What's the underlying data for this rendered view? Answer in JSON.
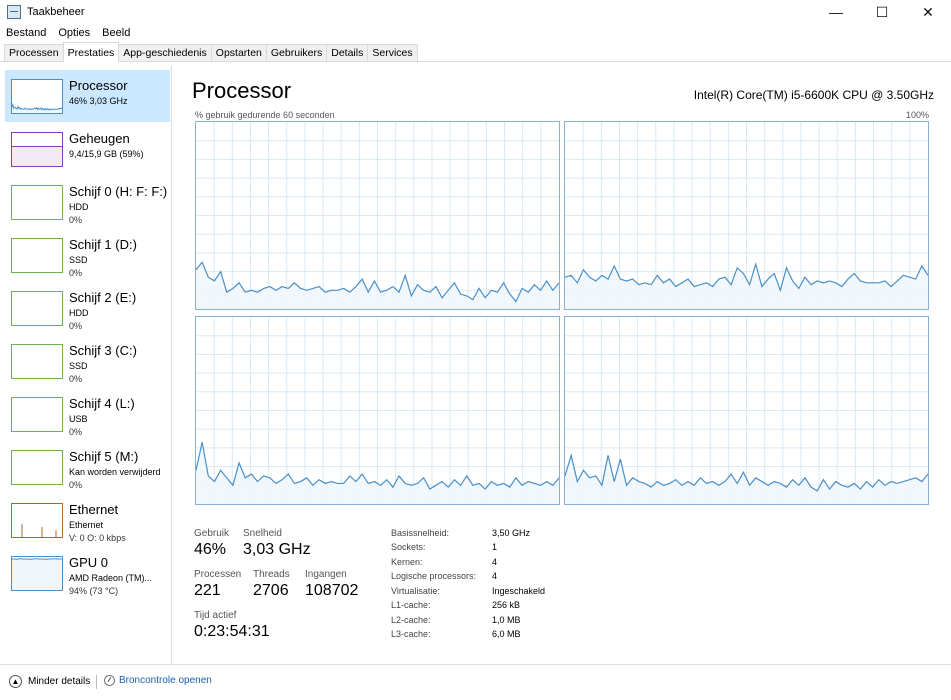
{
  "window": {
    "title": "Taakbeheer",
    "minimize": "—",
    "maximize": "☐",
    "close": "✕"
  },
  "menu": [
    "Bestand",
    "Opties",
    "Beeld"
  ],
  "tabs": [
    "Processen",
    "Prestaties",
    "App-geschiedenis",
    "Opstarten",
    "Gebruikers",
    "Details",
    "Services"
  ],
  "active_tab": "Prestaties",
  "sidebar": [
    {
      "name": "Processor",
      "line1": "46% 3,03 GHz",
      "line2": "",
      "color": "#4a90c8",
      "fill": "#f1f6fb",
      "active": true
    },
    {
      "name": "Geheugen",
      "line1": "9,4/15,9 GB (59%)",
      "line2": "",
      "color": "#8b3bb7",
      "fill": "#f3e9f8",
      "active": false
    },
    {
      "name": "Schijf 0 (H: F: F:)",
      "line1": "HDD",
      "line2": "0%",
      "color": "#6fb14a",
      "fill": "#ffffff",
      "active": false
    },
    {
      "name": "Schijf 1 (D:)",
      "line1": "SSD",
      "line2": "0%",
      "color": "#6fb14a",
      "fill": "#ffffff",
      "active": false
    },
    {
      "name": "Schijf 2 (E:)",
      "line1": "HDD",
      "line2": "0%",
      "color": "#6fb14a",
      "fill": "#ffffff",
      "active": false
    },
    {
      "name": "Schijf 3 (C:)",
      "line1": "SSD",
      "line2": "0%",
      "color": "#6fb14a",
      "fill": "#ffffff",
      "active": false
    },
    {
      "name": "Schijf 4 (L:)",
      "line1": "USB",
      "line2": "0%",
      "color": "#6fb14a",
      "fill": "#ffffff",
      "active": false
    },
    {
      "name": "Schijf 5 (M:)",
      "line1": "Kan worden verwijderd",
      "line2": "0%",
      "color": "#6fb14a",
      "fill": "#ffffff",
      "active": false
    },
    {
      "name": "Ethernet",
      "line1": "Ethernet",
      "line2": "V: 0 O: 0 kbps",
      "color": "#a7692a",
      "fill": "#ffffff",
      "active": false
    },
    {
      "name": "GPU 0",
      "line1": "AMD Radeon (TM)...",
      "line2": "94% (73 °C)",
      "color": "#4a90c8",
      "fill": "#f1f6fb",
      "active": false
    }
  ],
  "main": {
    "title": "Processor",
    "cpu_name": "Intel(R) Core(TM) i5-6600K CPU @ 3.50GHz",
    "graph_label": "% gebruik gedurende 60 seconden",
    "graph_max": "100%"
  },
  "stats": {
    "usage_label": "Gebruik",
    "usage": "46%",
    "speed_label": "Snelheid",
    "speed": "3,03 GHz",
    "processes_label": "Processen",
    "processes": "221",
    "threads_label": "Threads",
    "threads": "2706",
    "handles_label": "Ingangen",
    "handles": "108702",
    "uptime_label": "Tijd actief",
    "uptime": "0:23:54:31"
  },
  "specs": [
    {
      "label": "Basissnelheid:",
      "value": "3,50 GHz"
    },
    {
      "label": "Sockets:",
      "value": "1"
    },
    {
      "label": "Kernen:",
      "value": "4"
    },
    {
      "label": "Logische processors:",
      "value": "4"
    },
    {
      "label": "Virtualisatie:",
      "value": "Ingeschakeld"
    },
    {
      "label": "L1-cache:",
      "value": "256 kB"
    },
    {
      "label": "L2-cache:",
      "value": "1,0 MB"
    },
    {
      "label": "L3-cache:",
      "value": "6,0 MB"
    }
  ],
  "footer": {
    "fewer_details": "Minder details",
    "resource_monitor": "Broncontrole openen"
  },
  "colors": {
    "graph_line": "#4a90c8",
    "graph_fill": "#f1f6fb",
    "grid": "#d9e8f5",
    "graph_border": "#86b1d5",
    "link": "#1a5fb4"
  },
  "core_usage": [
    [
      21,
      25,
      17,
      15,
      20,
      9,
      11,
      14,
      9,
      10,
      9,
      11,
      12,
      10,
      12,
      11,
      14,
      11,
      10,
      11,
      12,
      9,
      10,
      10,
      11,
      9,
      12,
      16,
      9,
      15,
      9,
      10,
      12,
      9,
      18,
      7,
      13,
      10,
      9,
      12,
      6,
      10,
      14,
      8,
      7,
      5,
      11,
      6,
      10,
      9,
      14,
      8,
      4,
      11,
      9,
      13,
      10,
      15,
      10,
      14
    ],
    [
      17,
      18,
      14,
      21,
      17,
      15,
      18,
      16,
      23,
      16,
      15,
      16,
      13,
      14,
      13,
      18,
      14,
      16,
      12,
      14,
      16,
      12,
      13,
      14,
      12,
      16,
      17,
      13,
      22,
      19,
      13,
      24,
      12,
      16,
      19,
      10,
      22,
      15,
      11,
      17,
      13,
      15,
      14,
      15,
      14,
      12,
      16,
      19,
      15,
      14,
      14,
      14,
      15,
      12,
      15,
      18,
      17,
      16,
      23,
      18
    ],
    [
      18,
      33,
      15,
      12,
      18,
      14,
      10,
      22,
      14,
      16,
      12,
      15,
      14,
      11,
      13,
      16,
      11,
      12,
      14,
      10,
      13,
      11,
      12,
      11,
      11,
      15,
      12,
      16,
      11,
      12,
      10,
      13,
      9,
      15,
      11,
      10,
      11,
      14,
      8,
      10,
      12,
      9,
      13,
      10,
      15,
      10,
      11,
      8,
      12,
      10,
      11,
      9,
      14,
      10,
      12,
      11,
      10,
      12,
      10,
      14
    ],
    [
      15,
      26,
      12,
      18,
      14,
      15,
      10,
      26,
      12,
      24,
      10,
      14,
      12,
      11,
      9,
      12,
      10,
      11,
      13,
      10,
      12,
      10,
      14,
      11,
      12,
      10,
      12,
      16,
      11,
      17,
      10,
      14,
      12,
      10,
      12,
      11,
      9,
      13,
      10,
      14,
      9,
      7,
      13,
      8,
      12,
      10,
      9,
      11,
      8,
      12,
      9,
      13,
      10,
      12,
      11,
      12,
      13,
      14,
      12,
      16
    ]
  ]
}
